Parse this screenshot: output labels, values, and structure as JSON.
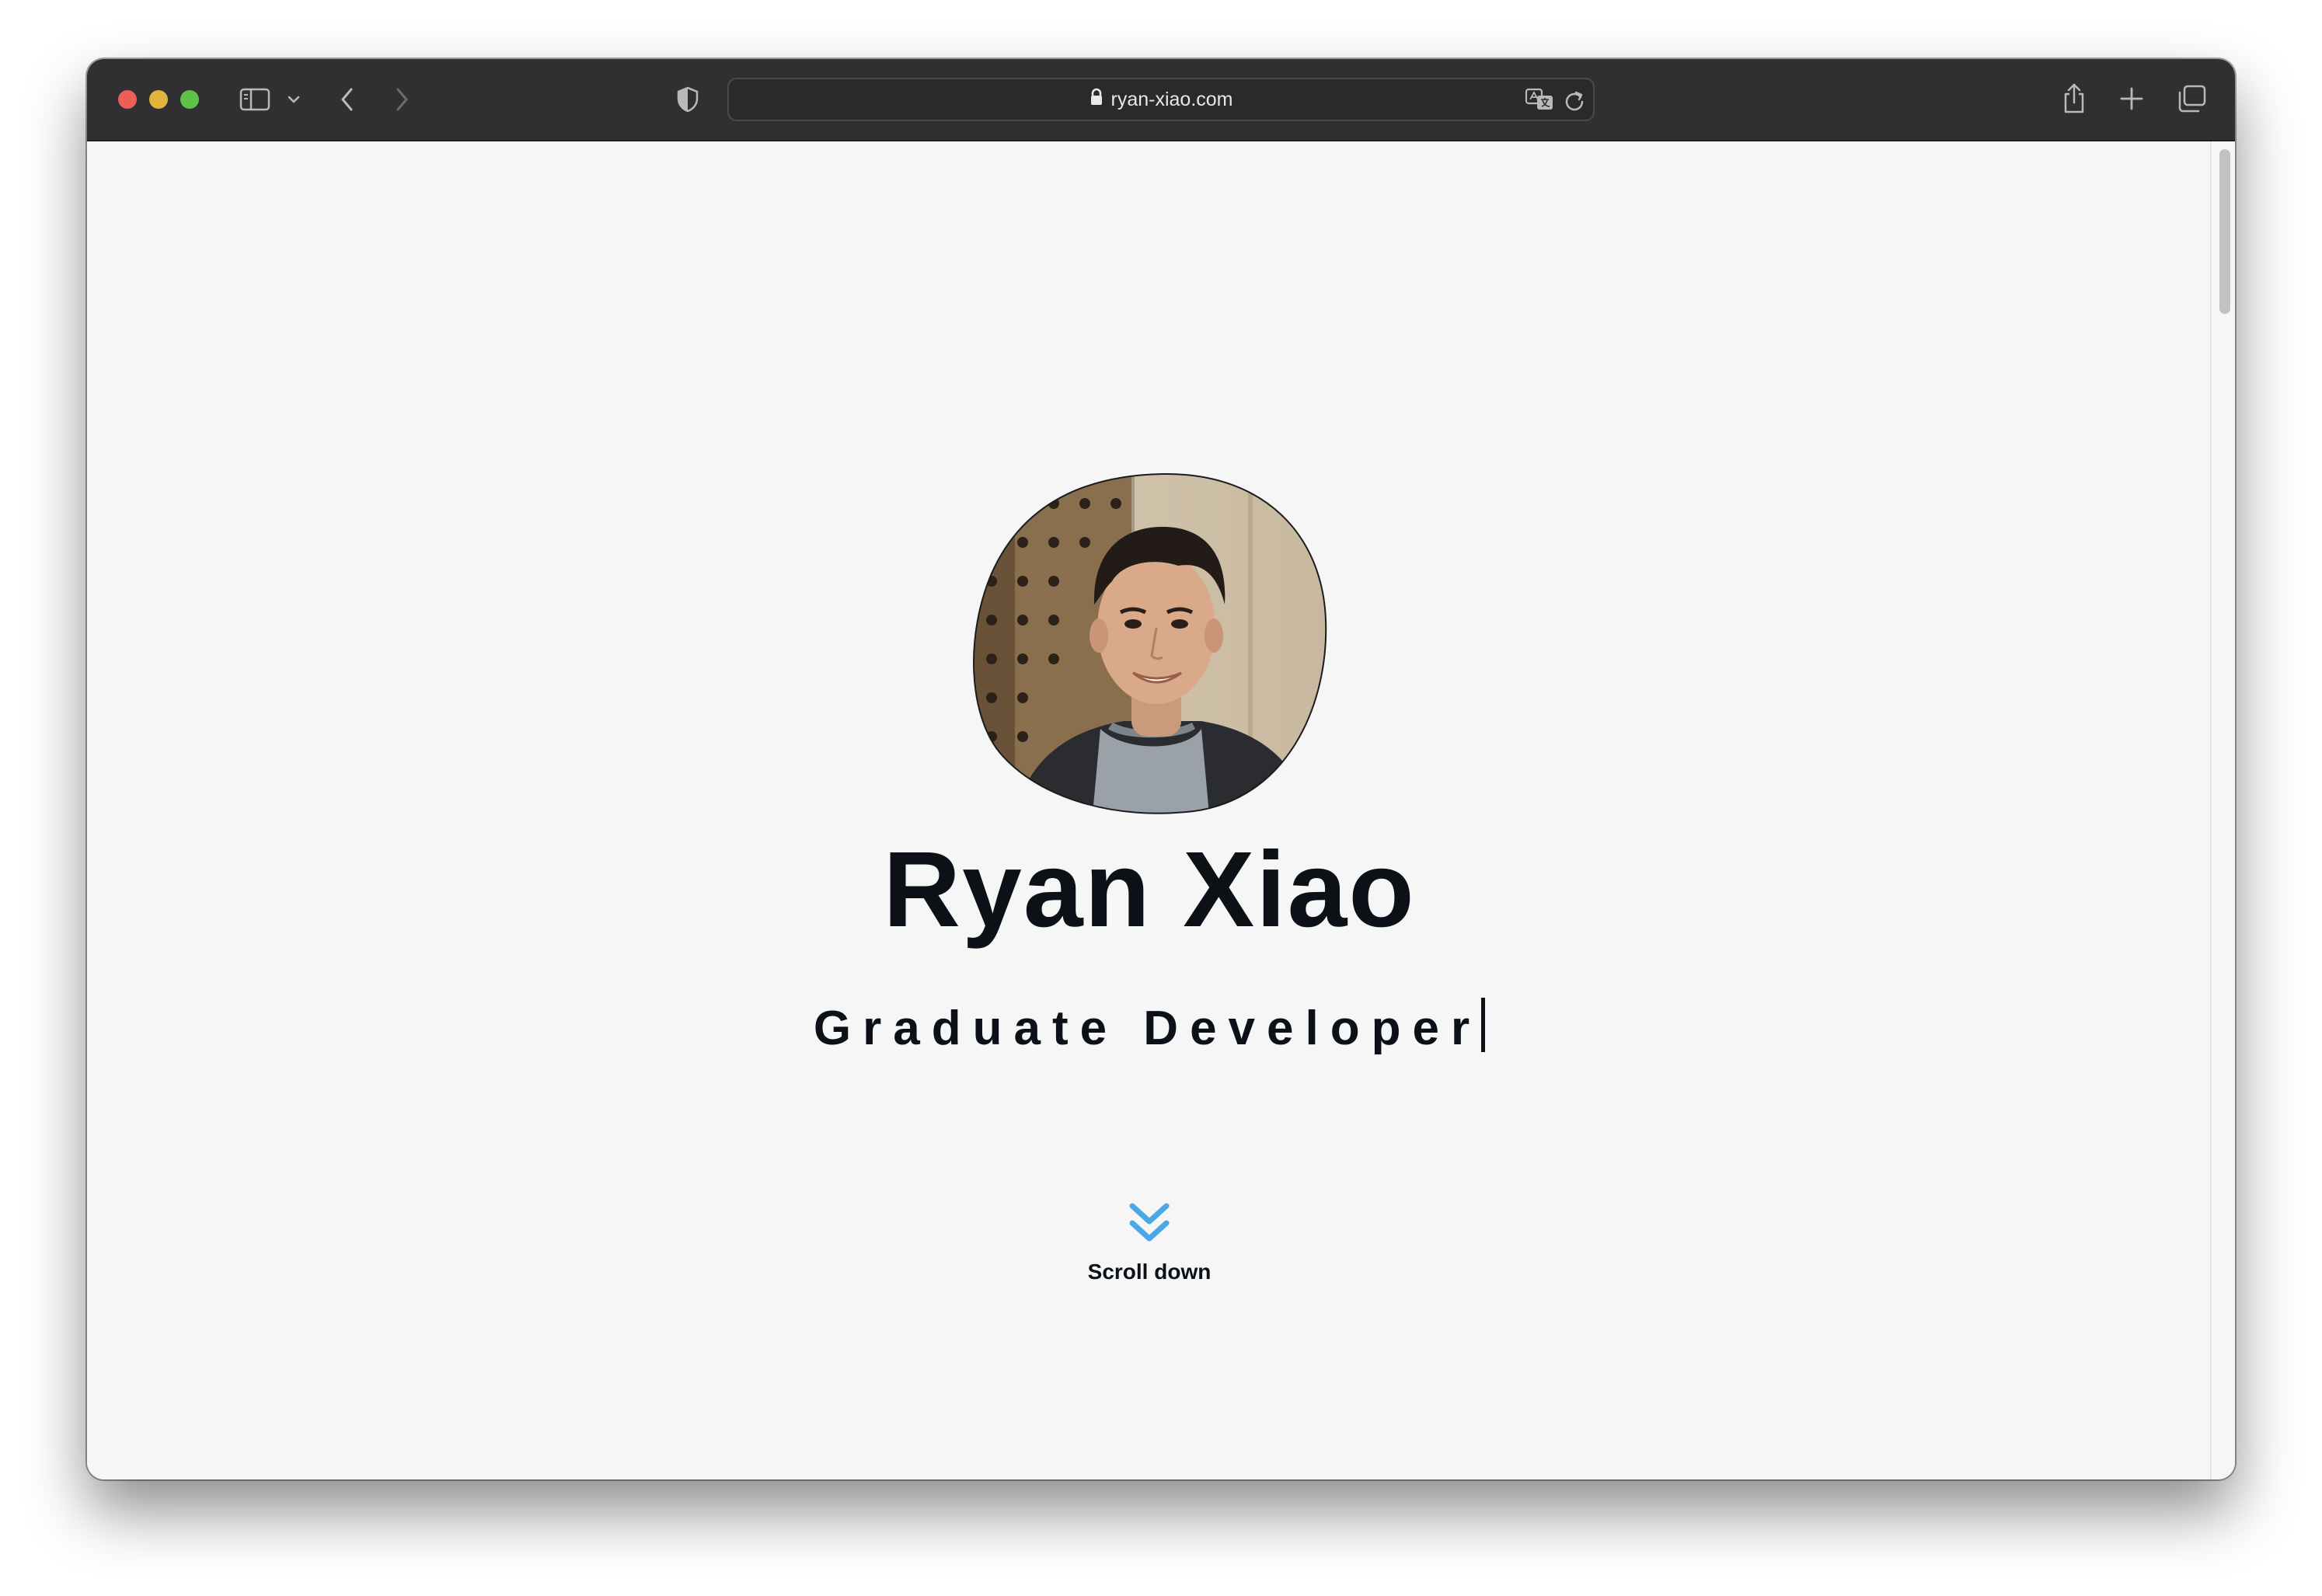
{
  "browser": {
    "url": "ryan-xiao.com",
    "icons": {
      "close": "close-icon",
      "minimize": "minimize-icon",
      "zoom": "zoom-icon",
      "sidebar": "sidebar-icon",
      "sidebar_menu": "chevron-down-icon",
      "back": "back-icon",
      "forward": "forward-icon",
      "privacy": "shield-icon",
      "lock": "lock-icon",
      "translate": "translate-icon",
      "reload": "reload-icon",
      "share": "share-icon",
      "new_tab": "plus-icon",
      "tab_overview": "tabs-icon"
    }
  },
  "hero": {
    "name": "Ryan Xiao",
    "role": "Graduate Developer",
    "scroll_label": "Scroll down"
  },
  "colors": {
    "toolbar": "#303032",
    "page_background": "#f6f6f6",
    "text": "#0b1117",
    "scroll_arrow": "#4aa8e8"
  }
}
